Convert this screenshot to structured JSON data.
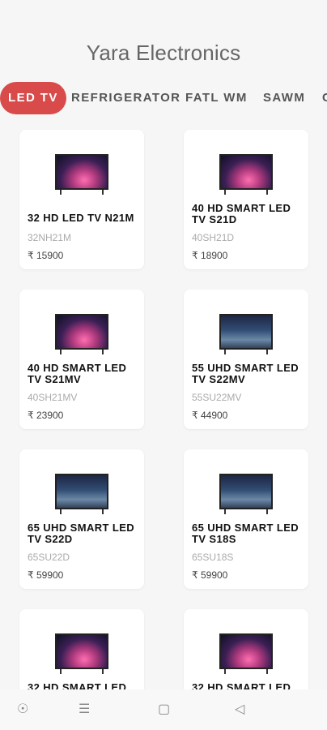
{
  "app": {
    "title": "Yara Electronics"
  },
  "tabs": [
    {
      "label": "LED TV",
      "active": true
    },
    {
      "label": "REFRIGERATOR",
      "active": false
    },
    {
      "label": "FATL WM",
      "active": false
    },
    {
      "label": "SAWM",
      "active": false
    },
    {
      "label": "C",
      "active": false
    }
  ],
  "products": [
    {
      "name": "32 HD LED TV N21M",
      "model": "32NH21M",
      "price": "₹ 15900",
      "image": "tv-galaxy"
    },
    {
      "name": "40 HD SMART LED TV S21D",
      "model": "40SH21D",
      "price": "₹ 18900",
      "image": "tv-galaxy"
    },
    {
      "name": "40 HD SMART LED TV S21MV",
      "model": "40SH21MV",
      "price": "₹ 23900",
      "image": "tv-galaxy"
    },
    {
      "name": "55 UHD SMART LED TV S22MV",
      "model": "55SU22MV",
      "price": "₹ 44900",
      "image": "tv-spiderman"
    },
    {
      "name": "65 UHD SMART LED TV S22D",
      "model": "65SU22D",
      "price": "₹ 59900",
      "image": "tv-spiderman"
    },
    {
      "name": "65 UHD SMART LED TV S18S",
      "model": "65SU18S",
      "price": "₹ 59900",
      "image": "tv-spiderman"
    },
    {
      "name": "32 HD SMART LED",
      "model": "",
      "price": "",
      "image": "tv-galaxy"
    },
    {
      "name": "32 HD SMART LED",
      "model": "",
      "price": "",
      "image": "tv-galaxy"
    }
  ],
  "nav": {
    "back_icon": "back-triangle-icon",
    "home_icon": "home-square-icon",
    "menu_icon": "menu-lines-icon",
    "assist_icon": "assistant-circle-icon"
  }
}
